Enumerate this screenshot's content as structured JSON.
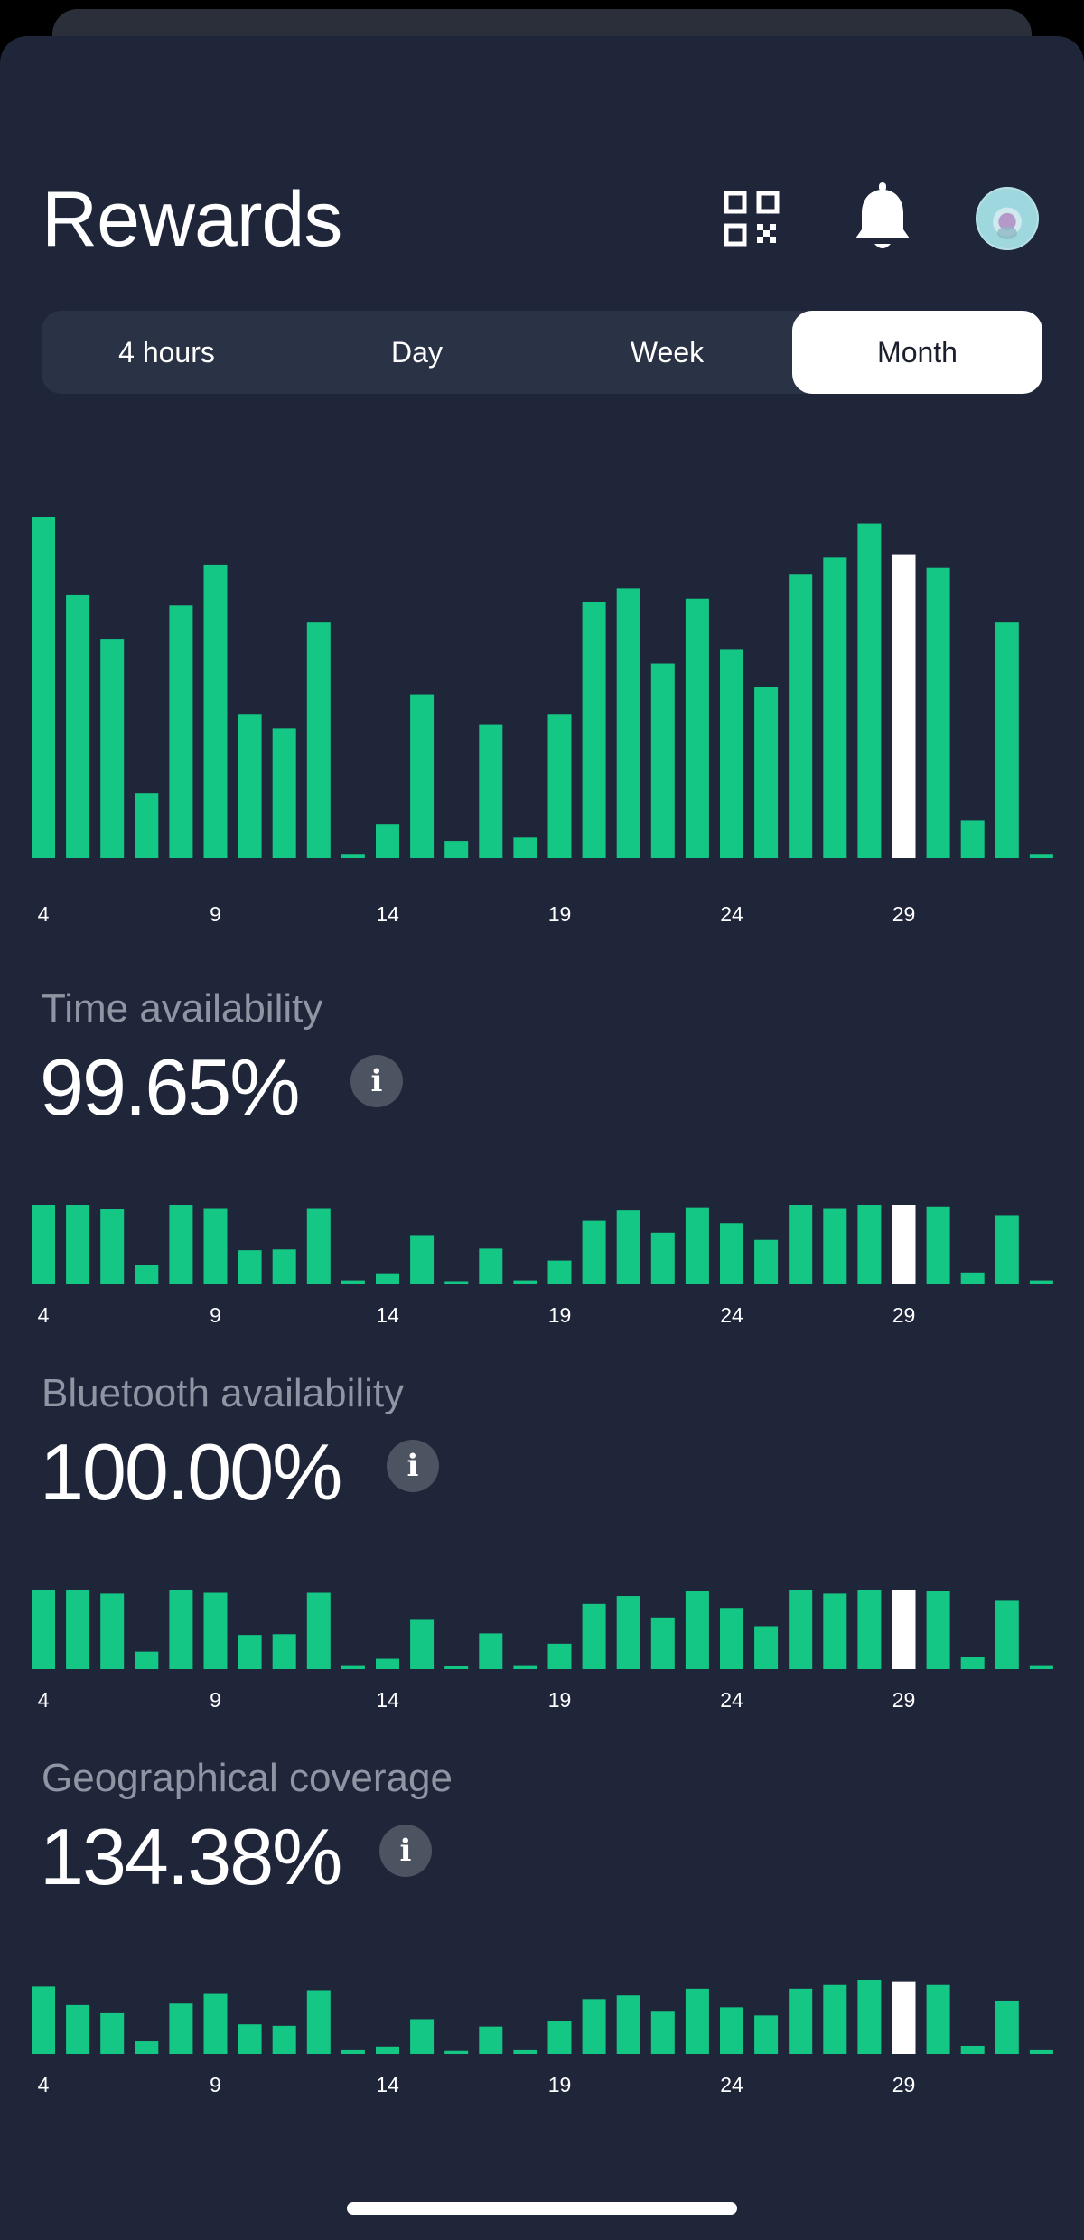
{
  "header": {
    "title": "Rewards",
    "qr_icon": "qr-code-icon",
    "bell_icon": "bell-icon",
    "avatar_icon": "user-avatar"
  },
  "periods": {
    "items": [
      "4 hours",
      "Day",
      "Week",
      "Month"
    ],
    "selected": "Month"
  },
  "colors": {
    "background": "#1f263a",
    "bar": "#14c785",
    "selected_bar": "#ffffff",
    "label_muted": "#8f96a3"
  },
  "chart_data": [
    {
      "type": "bar",
      "name": "rewards",
      "x": [
        4,
        5,
        6,
        7,
        8,
        9,
        10,
        11,
        12,
        13,
        14,
        15,
        16,
        17,
        18,
        19,
        20,
        21,
        22,
        23,
        24,
        25,
        26,
        27,
        28,
        29,
        30,
        31,
        32,
        33
      ],
      "x_ticks": [
        "4",
        "9",
        "14",
        "19",
        "24",
        "29"
      ],
      "values": [
        100,
        77,
        64,
        19,
        74,
        86,
        42,
        38,
        69,
        1,
        10,
        48,
        5,
        39,
        6,
        42,
        75,
        79,
        57,
        76,
        61,
        50,
        83,
        88,
        98,
        89,
        85,
        11,
        69,
        1
      ],
      "highlight_x": 29,
      "ylim": [
        0,
        100
      ]
    },
    {
      "type": "bar",
      "name": "time_availability",
      "label": "Time availability",
      "value_text": "99.65%",
      "x": [
        4,
        5,
        6,
        7,
        8,
        9,
        10,
        11,
        12,
        13,
        14,
        15,
        16,
        17,
        18,
        19,
        20,
        21,
        22,
        23,
        24,
        25,
        26,
        27,
        28,
        29,
        30,
        31,
        32,
        33
      ],
      "x_ticks": [
        "4",
        "9",
        "14",
        "19",
        "24",
        "29"
      ],
      "values": [
        100,
        100,
        95,
        24,
        100,
        96,
        43,
        44,
        96,
        5,
        14,
        62,
        4,
        45,
        5,
        30,
        80,
        93,
        65,
        97,
        77,
        56,
        100,
        96,
        100,
        100,
        98,
        15,
        87,
        5
      ],
      "highlight_x": 29,
      "ylim": [
        0,
        100
      ]
    },
    {
      "type": "bar",
      "name": "bluetooth_availability",
      "label": "Bluetooth availability",
      "value_text": "100.00%",
      "x": [
        4,
        5,
        6,
        7,
        8,
        9,
        10,
        11,
        12,
        13,
        14,
        15,
        16,
        17,
        18,
        19,
        20,
        21,
        22,
        23,
        24,
        25,
        26,
        27,
        28,
        29,
        30,
        31,
        32,
        33
      ],
      "x_ticks": [
        "4",
        "9",
        "14",
        "19",
        "24",
        "29"
      ],
      "values": [
        100,
        100,
        95,
        22,
        100,
        96,
        43,
        44,
        96,
        5,
        13,
        62,
        4,
        45,
        5,
        32,
        82,
        92,
        65,
        98,
        77,
        54,
        100,
        95,
        100,
        100,
        98,
        15,
        87,
        5
      ],
      "highlight_x": 29,
      "ylim": [
        0,
        100
      ]
    },
    {
      "type": "bar",
      "name": "geographical_coverage",
      "label": "Geographical coverage",
      "value_text": "134.38%",
      "x": [
        4,
        5,
        6,
        7,
        8,
        9,
        10,
        11,
        12,
        13,
        14,
        15,
        16,
        17,
        18,
        19,
        20,
        21,
        22,
        23,
        24,
        25,
        26,
        27,
        28,
        29,
        30,
        31,
        32,
        33
      ],
      "x_ticks": [
        "4",
        "9",
        "14",
        "19",
        "24",
        "29"
      ],
      "values": [
        91,
        66,
        55,
        17,
        68,
        81,
        40,
        38,
        86,
        5,
        10,
        47,
        4,
        37,
        5,
        44,
        74,
        79,
        57,
        88,
        63,
        52,
        88,
        93,
        100,
        98,
        93,
        11,
        72,
        5
      ],
      "highlight_x": 29,
      "ylim": [
        0,
        100
      ]
    }
  ]
}
